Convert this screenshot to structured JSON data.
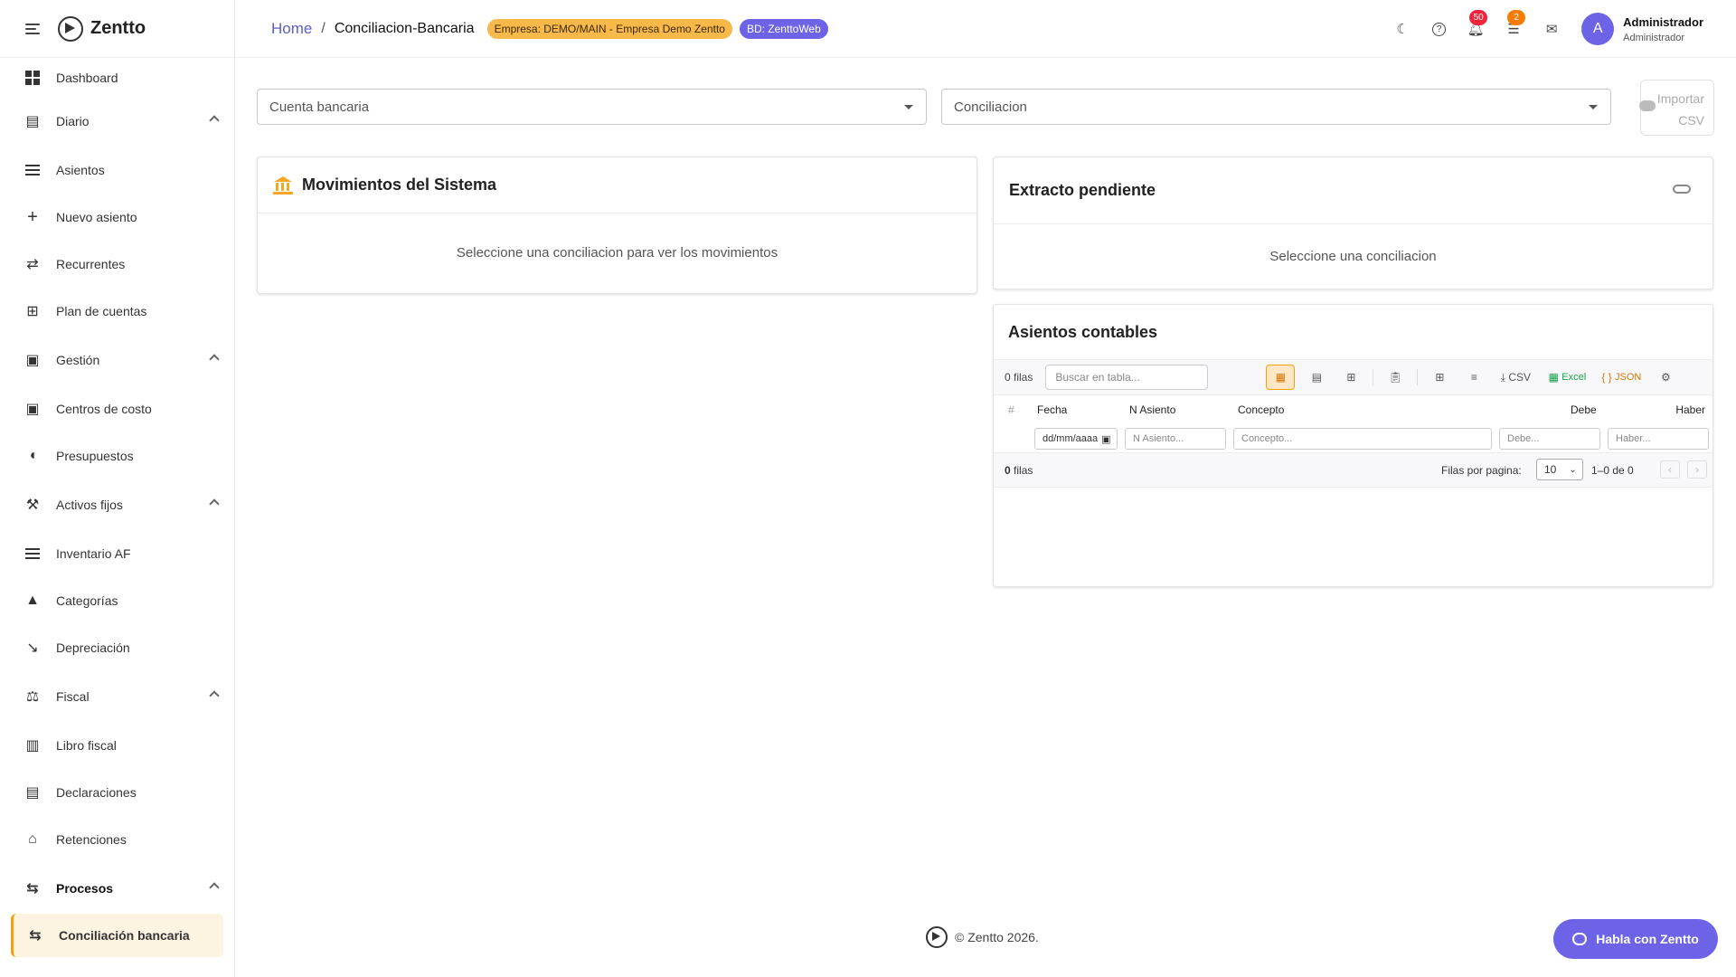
{
  "app": {
    "name": "Zentto"
  },
  "sidebar": {
    "items": [
      {
        "label": "Dashboard"
      },
      {
        "label": "Diario"
      },
      {
        "label": "Asientos"
      },
      {
        "label": "Nuevo asiento"
      },
      {
        "label": "Recurrentes"
      },
      {
        "label": "Plan de cuentas"
      },
      {
        "label": "Gestión"
      },
      {
        "label": "Centros de costo"
      },
      {
        "label": "Presupuestos"
      },
      {
        "label": "Activos fijos"
      },
      {
        "label": "Inventario AF"
      },
      {
        "label": "Categorías"
      },
      {
        "label": "Depreciación"
      },
      {
        "label": "Fiscal"
      },
      {
        "label": "Libro fiscal"
      },
      {
        "label": "Declaraciones"
      },
      {
        "label": "Retenciones"
      },
      {
        "label": "Procesos"
      },
      {
        "label": "Conciliación bancaria"
      }
    ]
  },
  "header": {
    "breadcrumb_home": "Home",
    "breadcrumb_sep": "/",
    "breadcrumb_current": "Conciliacion-Bancaria",
    "company_chip": "Empresa: DEMO/MAIN - Empresa Demo Zentto",
    "db_chip": "BD: ZenttoWeb",
    "notifications_count": "50",
    "tasks_count": "2",
    "avatar_initial": "A",
    "user_name": "Administrador",
    "user_role": "Administrador"
  },
  "filters": {
    "account_placeholder": "Cuenta bancaria",
    "reconciliation_placeholder": "Conciliacion",
    "import_label_1": "Importar",
    "import_label_2": "CSV"
  },
  "system_movements": {
    "title": "Movimientos del Sistema",
    "empty": "Seleccione una conciliacion para ver los movimientos"
  },
  "pending_statement": {
    "title": "Extracto pendiente",
    "empty": "Seleccione una conciliacion"
  },
  "entries": {
    "title": "Asientos contables",
    "row_count": "0 filas",
    "search_placeholder": "Buscar en tabla...",
    "csv_label": "CSV",
    "excel_label": "Excel",
    "json_label": "JSON",
    "columns": [
      "#",
      "Fecha",
      "N Asiento",
      "Concepto",
      "Debe",
      "Haber"
    ],
    "filter_date": "dd/mm/aaaa",
    "filter_asiento": "N Asiento...",
    "filter_concepto": "Concepto...",
    "filter_debe": "Debe...",
    "filter_haber": "Haber...",
    "footer_count_num": "0",
    "footer_count_word": "filas",
    "rows_per_page_label": "Filas por pagina:",
    "rows_per_page_value": "10",
    "pagination": "1–0 de 0",
    "prev": "‹",
    "next": "›"
  },
  "footer": {
    "credit": "© Zentto 2026."
  },
  "chat": {
    "label": "Habla con Zentto"
  }
}
